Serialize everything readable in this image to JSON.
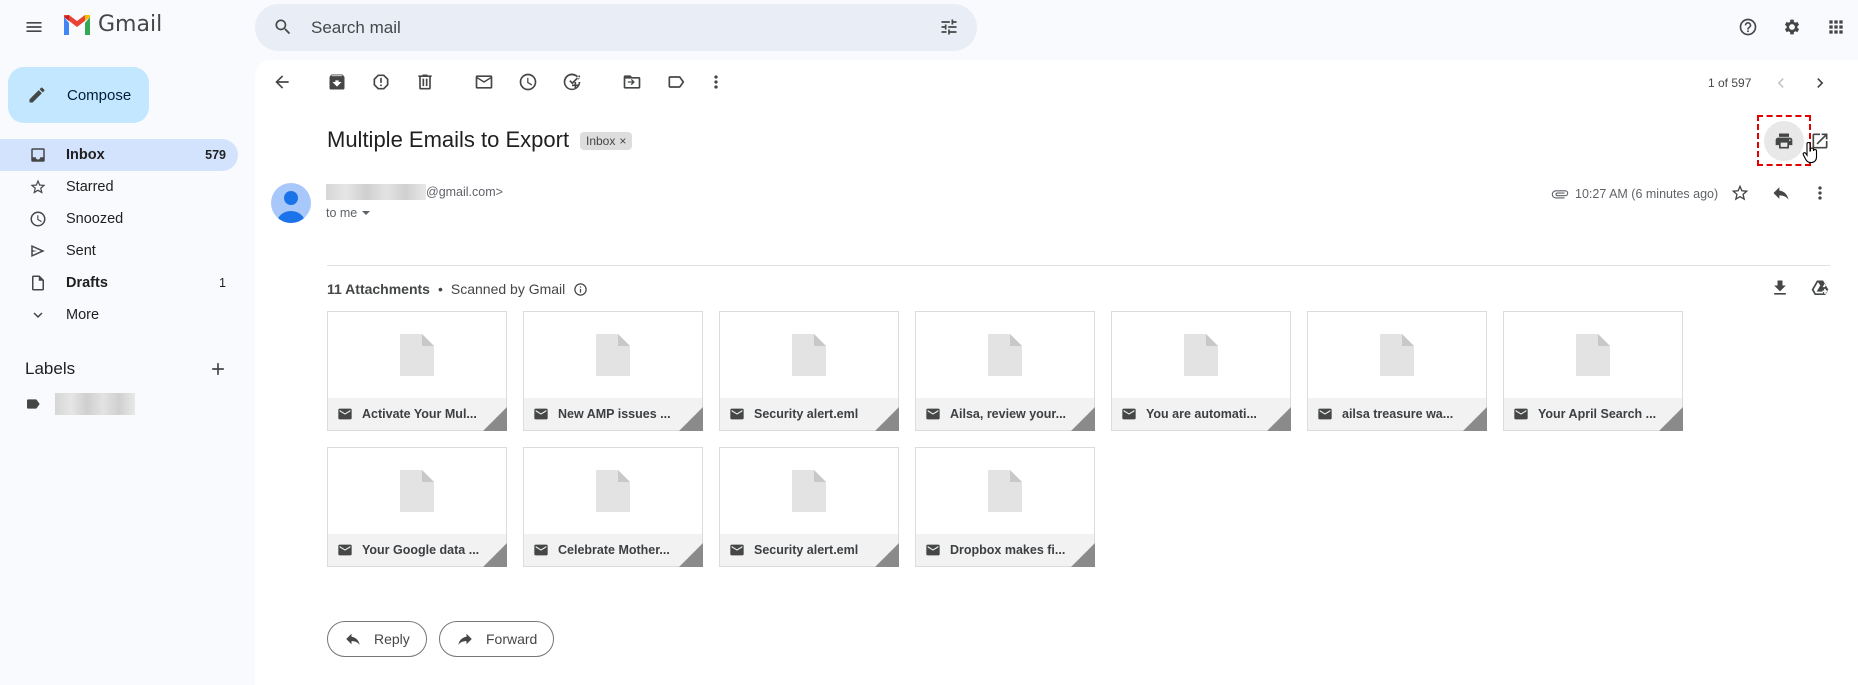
{
  "app": {
    "brand": "Gmail"
  },
  "search": {
    "placeholder": "Search mail"
  },
  "compose": {
    "label": "Compose"
  },
  "sidebar": {
    "items": [
      {
        "label": "Inbox",
        "count": "579"
      },
      {
        "label": "Starred",
        "count": ""
      },
      {
        "label": "Snoozed",
        "count": ""
      },
      {
        "label": "Sent",
        "count": ""
      },
      {
        "label": "Drafts",
        "count": "1"
      },
      {
        "label": "More",
        "count": ""
      }
    ],
    "labels_title": "Labels"
  },
  "toolbar": {
    "pager": "1 of 597"
  },
  "email": {
    "subject": "Multiple Emails to Export",
    "chip": "Inbox",
    "chip_close": "×",
    "sender_suffix": "@gmail.com>",
    "to": "to me",
    "timestamp": "10:27 AM (6 minutes ago)"
  },
  "attachments": {
    "count_label": "11 Attachments",
    "separator": "•",
    "scanned": "Scanned by Gmail",
    "items": [
      "Activate Your Mul...",
      "New AMP issues ...",
      "Security alert.eml",
      "Ailsa, review your...",
      "You are automati...",
      "ailsa treasure wa...",
      "Your April Search ...",
      "Your Google data ...",
      "Celebrate Mother...",
      "Security alert.eml",
      "Dropbox makes fi..."
    ]
  },
  "actions": {
    "reply": "Reply",
    "forward": "Forward"
  },
  "colors": {
    "accent": "#c2e7ff",
    "active_nav": "#d3e3fd",
    "highlight": "#e00000"
  }
}
